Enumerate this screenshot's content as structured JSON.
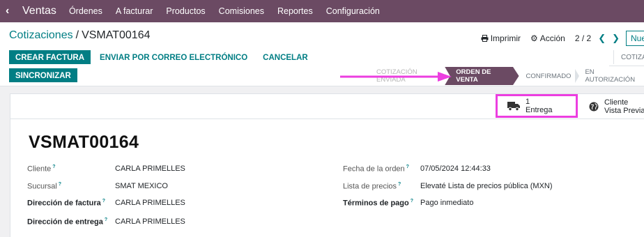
{
  "nav": {
    "app": "Ventas",
    "menu": [
      "Órdenes",
      "A facturar",
      "Productos",
      "Comisiones",
      "Reportes",
      "Configuración"
    ]
  },
  "breadcrumb": {
    "parent": "Cotizaciones",
    "sep": "/",
    "current": "VSMAT00164"
  },
  "toolbar": {
    "print": "Imprimir",
    "action": "Acción",
    "pager": "2 / 2",
    "new": "Nuevo"
  },
  "buttons": {
    "invoice": "CREAR FACTURA",
    "email": "ENVIAR POR CORREO ELECTRÓNICO",
    "cancel": "CANCELAR",
    "sync": "SINCRONIZAR",
    "cotiz_right": "COTIZA"
  },
  "stages": [
    {
      "label": "COTIZACIÓN ENVIADA",
      "state": "faded"
    },
    {
      "label": "ORDEN DE VENTA",
      "state": "active"
    },
    {
      "label": "CONFIRMADO",
      "state": "normal"
    },
    {
      "label": "EN AUTORIZACIÓN",
      "state": "normal"
    }
  ],
  "smart": {
    "delivery_count": "1",
    "delivery_label": "Entrega",
    "preview_line1": "Cliente",
    "preview_line2": "Vista Previa"
  },
  "record": {
    "name": "VSMAT00164",
    "left": [
      {
        "label": "Cliente",
        "value": "CARLA PRIMELLES",
        "bold": false
      },
      {
        "label": "Sucursal",
        "value": "SMAT MEXICO",
        "bold": false
      },
      {
        "label": "Dirección de factura",
        "value": "CARLA PRIMELLES",
        "bold": true
      },
      {
        "label": "Dirección de entrega",
        "value": "CARLA PRIMELLES",
        "bold": true
      }
    ],
    "right": [
      {
        "label": "Fecha de la orden",
        "value": "07/05/2024 12:44:33",
        "bold": false
      },
      {
        "label": "Lista de precios",
        "value": "Elevaté Lista de precios pública (MXN)",
        "bold": false
      },
      {
        "label": "Términos de pago",
        "value": "Pago inmediato",
        "bold": true
      }
    ]
  },
  "colors": {
    "brand": "#6b4a63",
    "accent": "#017e84",
    "highlight": "#ec3ee0"
  }
}
